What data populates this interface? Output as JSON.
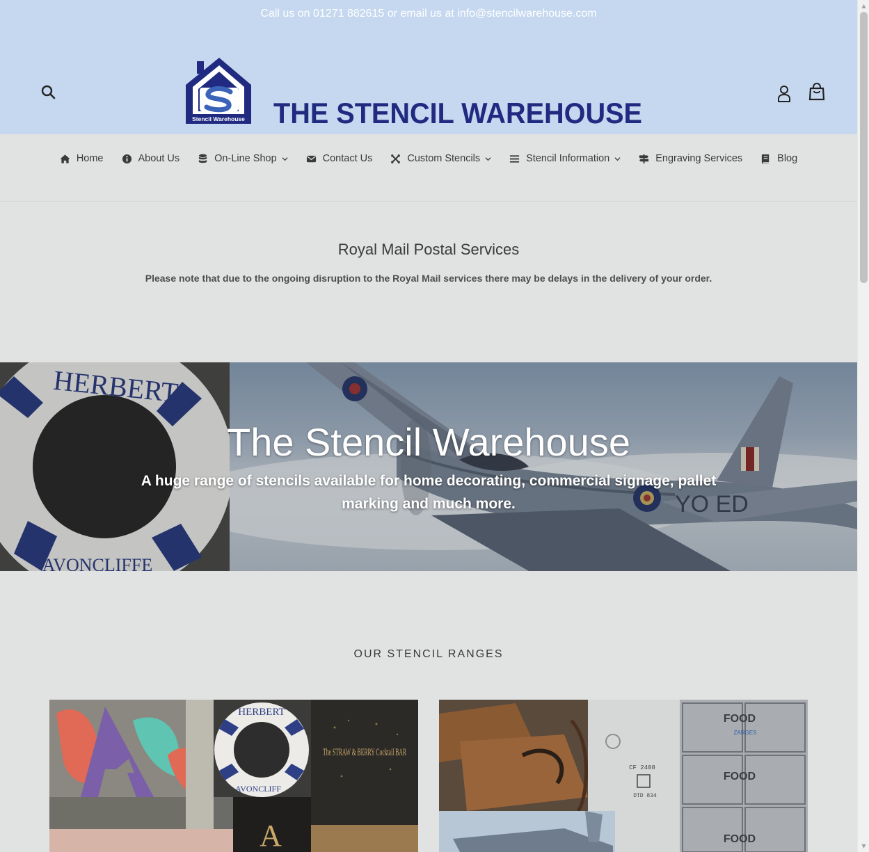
{
  "announcement": "Call us on 01271 882615 or email us at info@stencilwarehouse.com",
  "header": {
    "logo_text": "THE STENCIL WAREHOUSE",
    "logo_badge": "Stencil Warehouse",
    "search_icon": "search-icon",
    "account_icon": "user-icon",
    "cart_icon": "shopping-bag-icon"
  },
  "nav": {
    "items": [
      {
        "label": "Home",
        "icon": "home-icon",
        "dropdown": false
      },
      {
        "label": "About Us",
        "icon": "info-circle-icon",
        "dropdown": false
      },
      {
        "label": "On-Line Shop",
        "icon": "database-icon",
        "dropdown": true
      },
      {
        "label": "Contact Us",
        "icon": "envelope-icon",
        "dropdown": false
      },
      {
        "label": "Custom Stencils",
        "icon": "joomla-icon",
        "dropdown": true
      },
      {
        "label": "Stencil Information",
        "icon": "list-icon",
        "dropdown": true
      },
      {
        "label": "Engraving Services",
        "icon": "signpost-icon",
        "dropdown": false
      },
      {
        "label": "Blog",
        "icon": "book-icon",
        "dropdown": false
      }
    ]
  },
  "notice": {
    "title": "Royal Mail Postal Services",
    "text": "Please note that due to the ongoing disruption to the Royal Mail services there may be delays in the delivery of your order."
  },
  "hero": {
    "title": "The Stencil Warehouse",
    "subtitle": "A huge range of stencils available for home decorating, commercial signage, pallet marking and much more.",
    "lifering_text_top": "HERBERT",
    "lifering_text_bottom": "AVONCLIFFE",
    "plane_code": "YO ED"
  },
  "ranges": {
    "title": "OUR STENCIL RANGES",
    "card1": {
      "texts": [
        "HERBERT",
        "AVONCLIFF",
        "The STRAW & BERRY Cocktail BAR",
        "A"
      ]
    },
    "card2": {
      "texts": [
        "CF 2408",
        "DTD 834",
        "FOOD",
        "ZARGES"
      ]
    }
  },
  "colors": {
    "header_bg": "#c5d8f0",
    "page_bg": "#e1e2e2",
    "logo_blue": "#1f2a80",
    "text": "#3a3a3a"
  }
}
